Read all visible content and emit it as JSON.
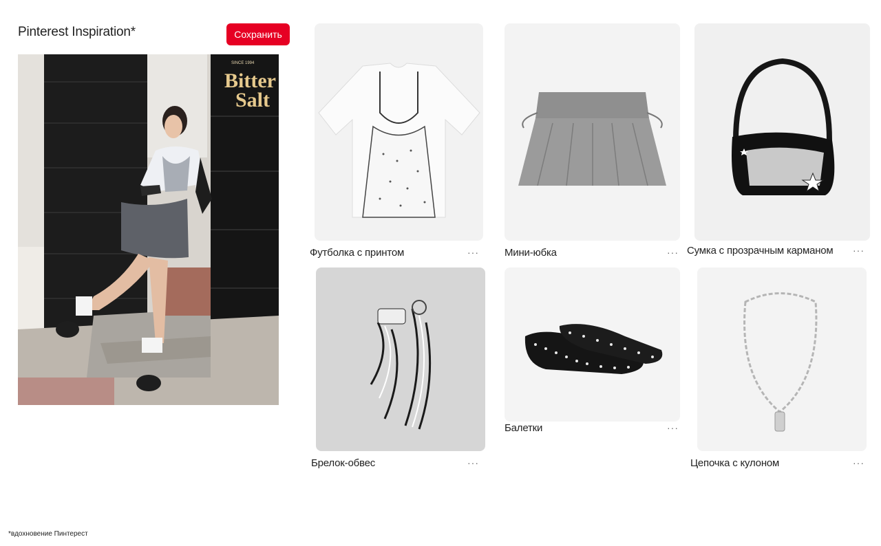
{
  "board": {
    "title": "Pinterest Inspiration*",
    "save_label": "Сохранить",
    "accent_color": "#e60023"
  },
  "hero": {
    "sign_line1": "SINCE 1994",
    "sign_line2": "Bitter",
    "sign_line3": "Salt"
  },
  "items": [
    {
      "label": "Футболка с принтом",
      "more": "···"
    },
    {
      "label": "Мини-юбка",
      "more": "···"
    },
    {
      "label": "Сумка с прозрачным карманом",
      "more": "···"
    },
    {
      "label": "Брелок-обвес",
      "more": "···"
    },
    {
      "label": "Балетки",
      "more": "···"
    },
    {
      "label": "Цепочка с кулоном",
      "more": "···"
    }
  ],
  "footnote": "*вдохновение Пинтерест"
}
